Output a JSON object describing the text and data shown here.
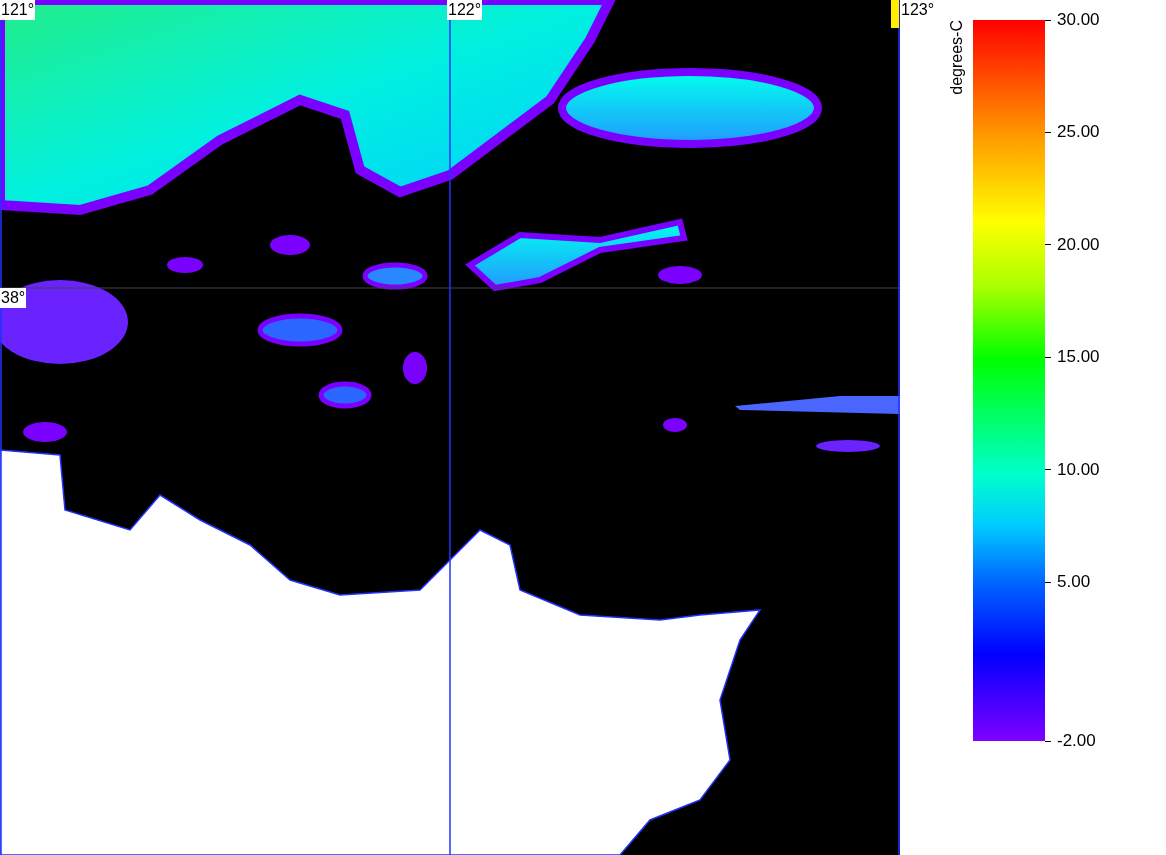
{
  "map": {
    "lon_labels": [
      "121°",
      "122°",
      "123°"
    ],
    "lat_labels": [
      "38°"
    ]
  },
  "colorbar": {
    "label": "degrees-C",
    "ticks": [
      "30.00",
      "25.00",
      "20.00",
      "15.00",
      "10.00",
      "5.00",
      "-2.00"
    ]
  }
}
